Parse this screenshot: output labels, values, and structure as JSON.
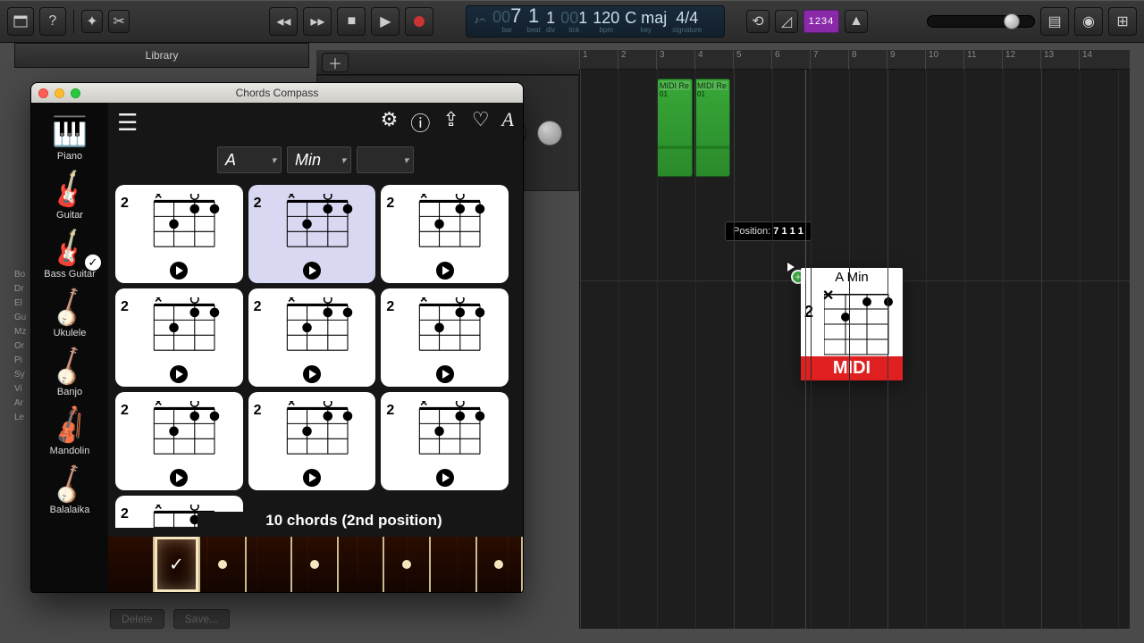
{
  "toolbar": {
    "lcd": {
      "bars": "7",
      "beats": "1",
      "div": "1",
      "tick": "1",
      "tempo": "120",
      "key": "C maj",
      "sig_num": "4",
      "sig_den": "4",
      "lbl_bar": "bar",
      "lbl_beat": "beat",
      "lbl_div": "div",
      "lbl_tick": "tick",
      "lbl_bpm": "bpm",
      "lbl_key": "key",
      "lbl_sig": "signature",
      "bars_pre": "00"
    },
    "count_in": "1234"
  },
  "library": {
    "title": "Library",
    "delete": "Delete",
    "save": "Save..."
  },
  "library_items": [
    "Bo",
    "Dr",
    "El",
    "Gu",
    "Mz",
    "Or",
    "Pi",
    "Sy",
    "Vi",
    "Ar",
    "Le"
  ],
  "ruler": {
    "bars": [
      "1",
      "2",
      "3",
      "4",
      "5",
      "6",
      "7",
      "8",
      "9",
      "10",
      "11",
      "12",
      "13",
      "14"
    ]
  },
  "regions": [
    {
      "name": "MIDI Re",
      "sub": "01"
    },
    {
      "name": "MIDI Re",
      "sub": "01"
    }
  ],
  "tooltip": {
    "label": "Position:",
    "value": "7 1 1 1"
  },
  "drag": {
    "title": "A Min",
    "fret": "2",
    "midi": "MIDI"
  },
  "cc": {
    "title": "Chords Compass",
    "instruments": [
      "Piano",
      "Guitar",
      "Bass Guitar",
      "Ukulele",
      "Banjo",
      "Mandolin",
      "Balalaika"
    ],
    "selected_instrument": 2,
    "root": "A",
    "type": "Min",
    "ext": "",
    "status": "10 chords (2nd position)",
    "chords": [
      {
        "fret": "2",
        "sel": false
      },
      {
        "fret": "2",
        "sel": true
      },
      {
        "fret": "2",
        "sel": false
      },
      {
        "fret": "2",
        "sel": false
      },
      {
        "fret": "2",
        "sel": false
      },
      {
        "fret": "2",
        "sel": false
      },
      {
        "fret": "2",
        "sel": false
      },
      {
        "fret": "2",
        "sel": false
      },
      {
        "fret": "2",
        "sel": false
      },
      {
        "fret": "2",
        "sel": false
      }
    ],
    "neck_markers": [
      2,
      4,
      6,
      8
    ],
    "neck_selected": 1
  }
}
